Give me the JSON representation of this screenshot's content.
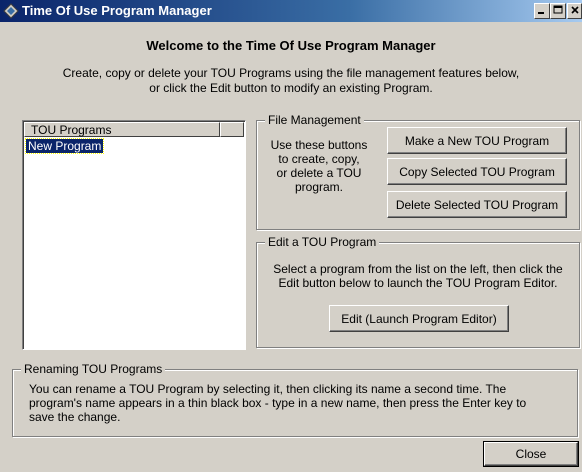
{
  "window": {
    "title": "Time Of Use Program Manager",
    "controls": [
      "minimize",
      "maximize",
      "close"
    ]
  },
  "header": {
    "welcome": "Welcome to the Time Of Use Program Manager",
    "intro_line1": "Create, copy or delete your TOU Programs using the file management features below,",
    "intro_line2": "or click the Edit button to modify an existing Program."
  },
  "program_list": {
    "column_header": "TOU Programs",
    "items": [
      {
        "label": "New Program",
        "selected": true
      }
    ]
  },
  "file_management": {
    "legend": "File Management",
    "help_lines": [
      "Use these buttons",
      "to create, copy,",
      "or delete a TOU",
      "program."
    ],
    "new_button": "Make a New TOU Program",
    "copy_button": "Copy Selected TOU Program",
    "delete_button": "Delete Selected TOU Program"
  },
  "edit_program": {
    "legend": "Edit a TOU Program",
    "help_line1": "Select a program from the list on the left, then click the",
    "help_line2": "Edit button below to launch the TOU Program Editor.",
    "edit_button": "Edit (Launch Program Editor)"
  },
  "renaming": {
    "legend": "Renaming TOU Programs",
    "line1": "You can rename a TOU Program by selecting it, then clicking its name a second time. The",
    "line2": "program's name appears in a thin black box - type in a new name, then press the Enter key to",
    "line3": "save the change."
  },
  "footer": {
    "close_button": "Close"
  }
}
